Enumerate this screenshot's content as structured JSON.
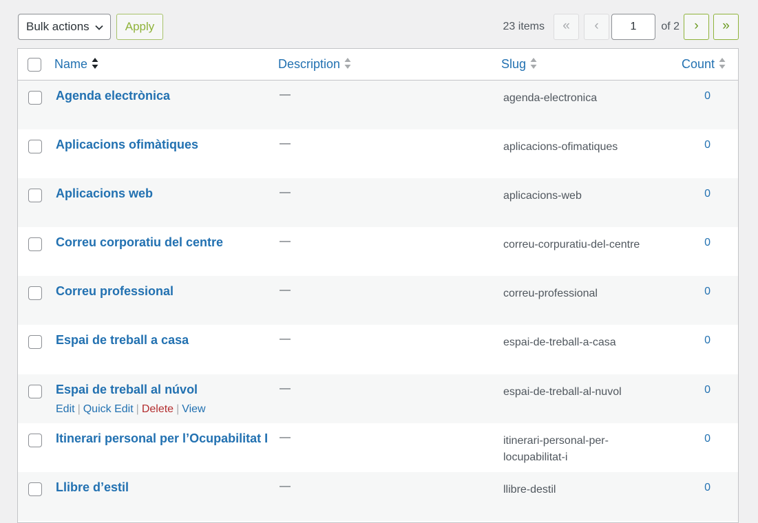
{
  "toolbar": {
    "bulk_actions_label": "Bulk actions",
    "apply_label": "Apply"
  },
  "pagination": {
    "items_count": "23 items",
    "first": "«",
    "prev": "‹",
    "current_page": "1",
    "of_total": "of 2",
    "next": "›",
    "last": "»"
  },
  "columns": {
    "name": "Name",
    "description": "Description",
    "slug": "Slug",
    "count": "Count"
  },
  "rows": [
    {
      "name": "Agenda electrònica",
      "description": "—",
      "slug": "agenda-electronica",
      "count": "0"
    },
    {
      "name": "Aplicacions ofimàtiques",
      "description": "—",
      "slug": "aplicacions-ofimatiques",
      "count": "0"
    },
    {
      "name": "Aplicacions web",
      "description": "—",
      "slug": "aplicacions-web",
      "count": "0"
    },
    {
      "name": "Correu corporatiu del centre",
      "description": "—",
      "slug": "correu-corpuratiu-del-centre",
      "count": "0"
    },
    {
      "name": "Correu professional",
      "description": "—",
      "slug": "correu-professional",
      "count": "0"
    },
    {
      "name": "Espai de treball a casa",
      "description": "—",
      "slug": "espai-de-treball-a-casa",
      "count": "0"
    },
    {
      "name": "Espai de treball al núvol",
      "description": "—",
      "slug": "espai-de-treball-al-nuvol",
      "count": "0"
    },
    {
      "name": "Itinerari personal per l’Ocupabilitat I",
      "description": "—",
      "slug": "itinerari-personal-per-locupabilitat-i",
      "count": "0"
    },
    {
      "name": "Llibre d’estil",
      "description": "—",
      "slug": "llibre-destil",
      "count": "0"
    }
  ],
  "row_actions": {
    "edit": "Edit",
    "quick_edit": "Quick Edit",
    "delete": "Delete",
    "view": "View",
    "separator": "|"
  },
  "colors": {
    "link": "#2271b1",
    "delete": "#b32d2e",
    "accent_green": "#8fb33a"
  }
}
